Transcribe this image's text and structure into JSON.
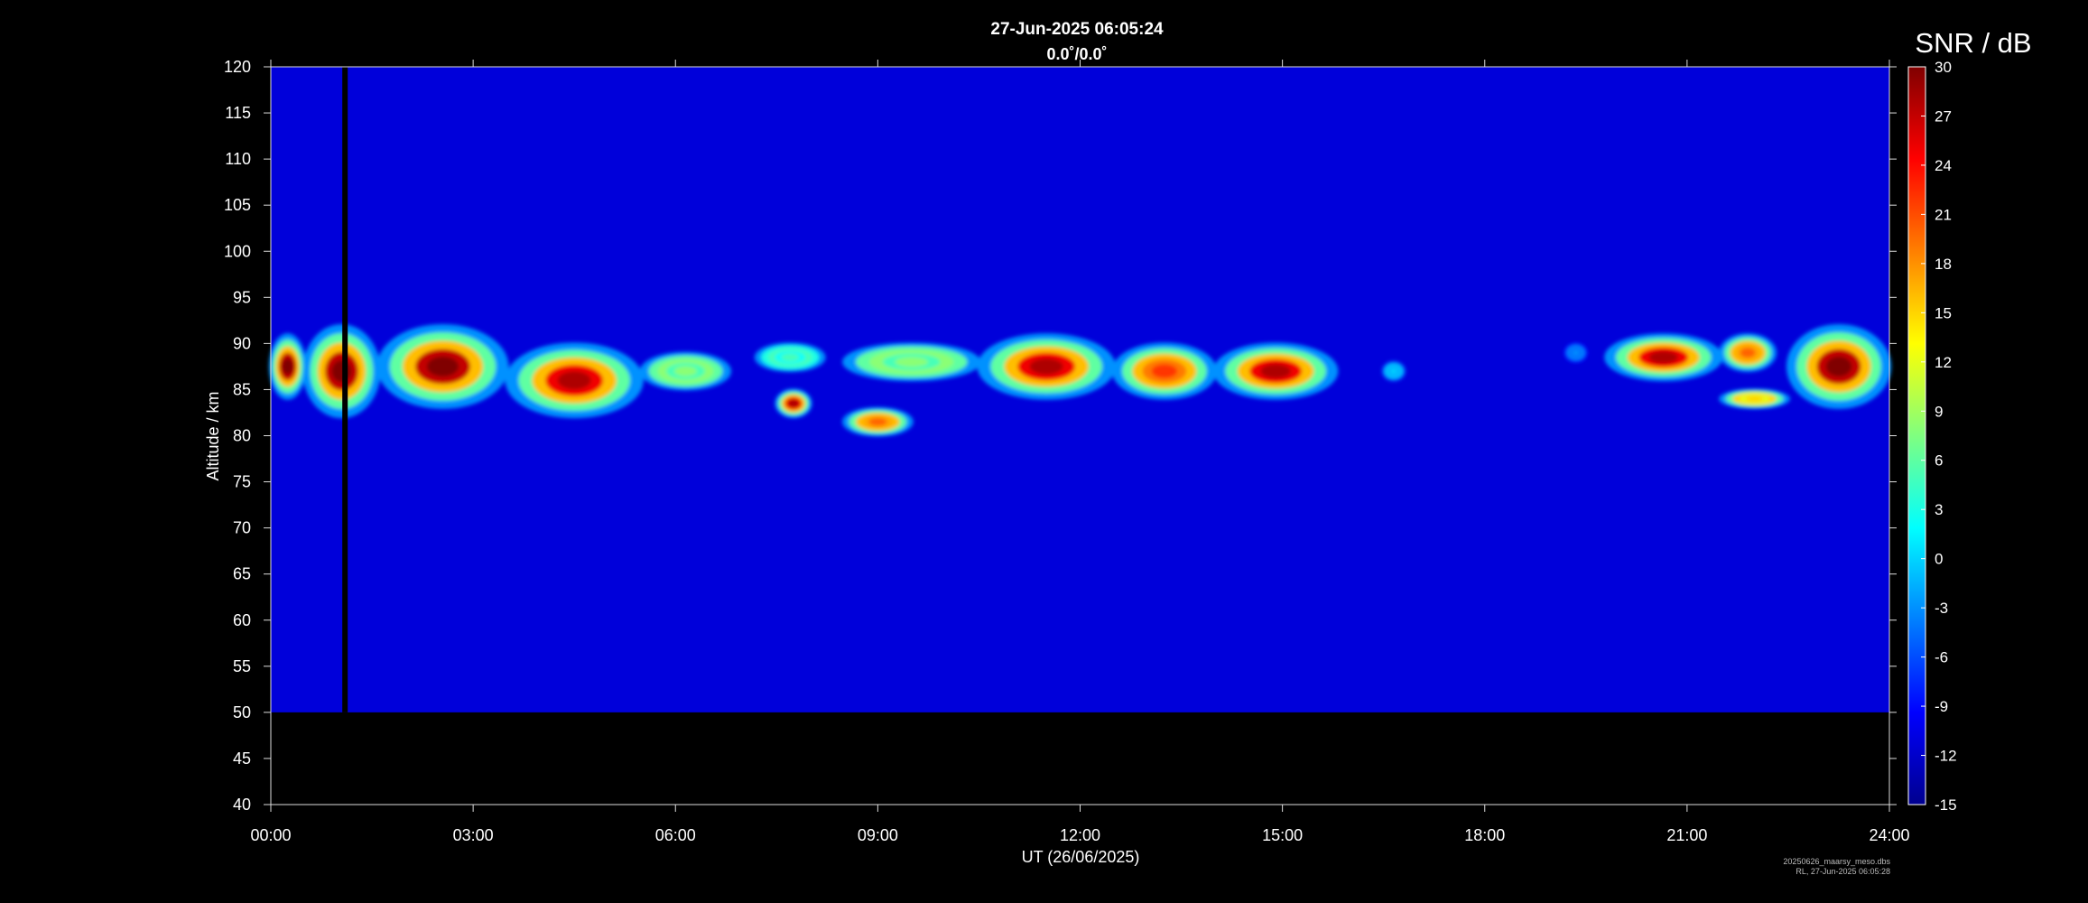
{
  "chart_data": {
    "type": "heatmap",
    "title": "27-Jun-2025 06:05:24",
    "subtitle": "0.0˚/0.0˚",
    "xlabel": "UT (26/06/2025)",
    "ylabel": "Altitude / km",
    "xlim": [
      0,
      24
    ],
    "ylim": [
      40,
      120
    ],
    "x_ticks": [
      "00:00",
      "03:00",
      "06:00",
      "09:00",
      "12:00",
      "15:00",
      "18:00",
      "21:00",
      "24:00"
    ],
    "y_ticks": [
      40,
      45,
      50,
      55,
      60,
      65,
      70,
      75,
      80,
      85,
      90,
      95,
      100,
      105,
      110,
      115,
      120
    ],
    "data_altitude_range": [
      50,
      120
    ],
    "data_gap_time_hours": 1.1,
    "background_snr_db": -11,
    "colorbar": {
      "title": "SNR / dB",
      "range": [
        -15,
        30
      ],
      "ticks": [
        30,
        27,
        24,
        21,
        18,
        15,
        12,
        9,
        6,
        3,
        0,
        -3,
        -6,
        -9,
        -12,
        -15
      ],
      "colormap": "jet"
    },
    "echo_regions": [
      {
        "t_start": 0.0,
        "t_end": 0.5,
        "alt_low": 84,
        "alt_high": 91,
        "peak_snr_db": 30
      },
      {
        "t_start": 0.5,
        "t_end": 1.6,
        "alt_low": 82,
        "alt_high": 92,
        "peak_snr_db": 30
      },
      {
        "t_start": 1.6,
        "t_end": 3.5,
        "alt_low": 83,
        "alt_high": 92,
        "peak_snr_db": 30
      },
      {
        "t_start": 3.5,
        "t_end": 5.5,
        "alt_low": 82,
        "alt_high": 90,
        "peak_snr_db": 28
      },
      {
        "t_start": 5.5,
        "t_end": 6.8,
        "alt_low": 85,
        "alt_high": 89,
        "peak_snr_db": 8
      },
      {
        "t_start": 7.2,
        "t_end": 8.2,
        "alt_low": 87,
        "alt_high": 90,
        "peak_snr_db": 5
      },
      {
        "t_start": 7.5,
        "t_end": 8.0,
        "alt_low": 82,
        "alt_high": 85,
        "peak_snr_db": 28
      },
      {
        "t_start": 8.5,
        "t_end": 9.5,
        "alt_low": 80,
        "alt_high": 83,
        "peak_snr_db": 20
      },
      {
        "t_start": 8.5,
        "t_end": 10.5,
        "alt_low": 86,
        "alt_high": 90,
        "peak_snr_db": 8
      },
      {
        "t_start": 10.5,
        "t_end": 12.5,
        "alt_low": 84,
        "alt_high": 91,
        "peak_snr_db": 28
      },
      {
        "t_start": 12.5,
        "t_end": 14.0,
        "alt_low": 84,
        "alt_high": 90,
        "peak_snr_db": 22
      },
      {
        "t_start": 14.0,
        "t_end": 15.8,
        "alt_low": 84,
        "alt_high": 90,
        "peak_snr_db": 28
      },
      {
        "t_start": 16.5,
        "t_end": 16.8,
        "alt_low": 86,
        "alt_high": 88,
        "peak_snr_db": 0
      },
      {
        "t_start": 19.2,
        "t_end": 19.5,
        "alt_low": 88,
        "alt_high": 90,
        "peak_snr_db": -3
      },
      {
        "t_start": 19.8,
        "t_end": 21.5,
        "alt_low": 86,
        "alt_high": 91,
        "peak_snr_db": 28
      },
      {
        "t_start": 21.5,
        "t_end": 22.3,
        "alt_low": 87,
        "alt_high": 91,
        "peak_snr_db": 20
      },
      {
        "t_start": 21.5,
        "t_end": 22.5,
        "alt_low": 83,
        "alt_high": 85,
        "peak_snr_db": 15
      },
      {
        "t_start": 22.5,
        "t_end": 24.0,
        "alt_low": 83,
        "alt_high": 92,
        "peak_snr_db": 30
      }
    ]
  },
  "footer": {
    "file_name": "20250626_maarsy_meso.dbs",
    "generated": "RL, 27-Jun-2025 06:05:28"
  }
}
